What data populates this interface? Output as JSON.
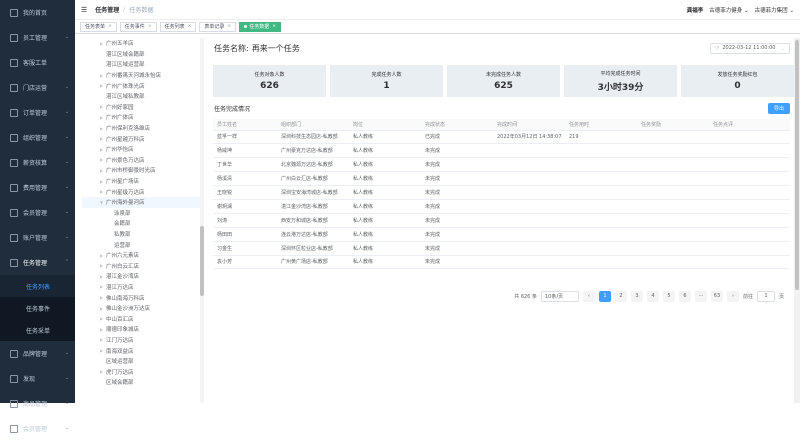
{
  "sidebar": {
    "items": [
      {
        "label": "我的首页",
        "icon": "home-icon"
      },
      {
        "label": "员工管理",
        "icon": "user-icon"
      },
      {
        "label": "客服工单",
        "icon": "ticket-icon"
      },
      {
        "label": "门店运营",
        "icon": "store-icon"
      },
      {
        "label": "订单管理",
        "icon": "order-icon"
      },
      {
        "label": "组织管理",
        "icon": "org-icon"
      },
      {
        "label": "薪资核算",
        "icon": "salary-icon"
      },
      {
        "label": "费用管理",
        "icon": "expense-icon"
      },
      {
        "label": "会员管理",
        "icon": "member-icon"
      },
      {
        "label": "账户管理",
        "icon": "account-icon"
      },
      {
        "label": "任务管理",
        "icon": "task-icon"
      }
    ],
    "sub_items": [
      "任务列表",
      "任务事件",
      "任务采单"
    ],
    "bottom_items": [
      {
        "label": "品牌管理",
        "icon": "brand-icon"
      },
      {
        "label": "发现",
        "icon": "discover-icon"
      },
      {
        "label": "商品管理",
        "icon": "goods-icon"
      },
      {
        "label": "会员管理",
        "icon": "member-icon"
      }
    ]
  },
  "header": {
    "breadcrumb": [
      "任务管理",
      "任务数据"
    ],
    "user": "龚福李",
    "org1": "古德菲力健身",
    "org2": "古德菲力集团"
  },
  "tabs": [
    {
      "label": "任务表单"
    },
    {
      "label": "任务事件"
    },
    {
      "label": "任务列表"
    },
    {
      "label": "表单记录"
    },
    {
      "label": "任务数据",
      "active": true
    }
  ],
  "tree": [
    "广州五羊店",
    "湛江区域会籍部",
    "湛江区域运营部",
    "广州番禺天河城永怡店",
    "广州广体珠光店",
    "湛江区域私教部",
    "广州好家园",
    "广州广体店",
    "广州保利克洛维店",
    "广州星越万科店",
    "广州华怡店",
    "广州景色万达店",
    "广州市桥御景时光店",
    "广州星广场店",
    "广州星级万达店",
    "广州海外曼河店",
    "泳泉部",
    "会籍部",
    "私教部",
    "运营部",
    "广州六元素店",
    "广州白云汇店",
    "湛江金沙湾店",
    "湛江万达店",
    "佛山南海万科店",
    "佛山金沙洲万达店",
    "中山百汇店",
    "顺德印象城店",
    "江门万达店",
    "南海双益店",
    "区域运营部",
    "虎门万达店",
    "区域会籍部"
  ],
  "main": {
    "task_label": "任务名称:",
    "task_name": "再来一个任务",
    "date": "2022-03-12 11:00:00",
    "stats": [
      {
        "label": "任务对象人数",
        "value": "626"
      },
      {
        "label": "完成任务人数",
        "value": "1"
      },
      {
        "label": "未完成任务人数",
        "value": "625"
      },
      {
        "label": "平均完成任务时间",
        "value": "3小时39分"
      },
      {
        "label": "发放任务奖励红包",
        "value": "0"
      }
    ],
    "section_title": "任务完成情况",
    "export_label": "导出",
    "columns": [
      "员工姓名",
      "组织部门",
      "岗位",
      "完成状态",
      "完成时间",
      "任务用时",
      "任务奖励",
      "任务点评"
    ],
    "rows": [
      [
        "蓝孚一样",
        "深圳科技生态园店-私教部",
        "私人教练",
        "已完成",
        "2022年03月12日 14:38:07",
        "219",
        "",
        ""
      ],
      [
        "杨威坤",
        "广州豪克万达店-私教部",
        "私人教练",
        "未完成",
        "",
        "",
        "",
        ""
      ],
      [
        "丁世华",
        "北京魏源万达店-私教部",
        "私人教练",
        "未完成",
        "",
        "",
        "",
        ""
      ],
      [
        "杨溪清",
        "广州白云汇店-私教部",
        "私人教练",
        "未完成",
        "",
        "",
        "",
        ""
      ],
      [
        "王晓锐",
        "深圳宝安海湾城店-私教部",
        "私人教练",
        "未完成",
        "",
        "",
        "",
        ""
      ],
      [
        "谢玥澜",
        "湛江金沙湾店-私教部",
        "私人教练",
        "未完成",
        "",
        "",
        "",
        ""
      ],
      [
        "刘涛",
        "西安万和城店-私教部",
        "私人教练",
        "未完成",
        "",
        "",
        "",
        ""
      ],
      [
        "杨田田",
        "连云港万达店-私教部",
        "私人教练",
        "未完成",
        "",
        "",
        "",
        ""
      ],
      [
        "习金生",
        "深圳怀区粒业店-私教部",
        "私人教练",
        "未完成",
        "",
        "",
        "",
        ""
      ],
      [
        "袁小芳",
        "广州黄广场店-私教部",
        "私人教练",
        "未完成",
        "",
        "",
        "",
        ""
      ]
    ],
    "pager": {
      "total": "共 626 条",
      "size": "10条/页",
      "pages": [
        "1",
        "2",
        "3",
        "4",
        "5",
        "6",
        "···",
        "63"
      ],
      "goto_label": "前往",
      "goto_value": "1",
      "page_unit": "页"
    }
  }
}
